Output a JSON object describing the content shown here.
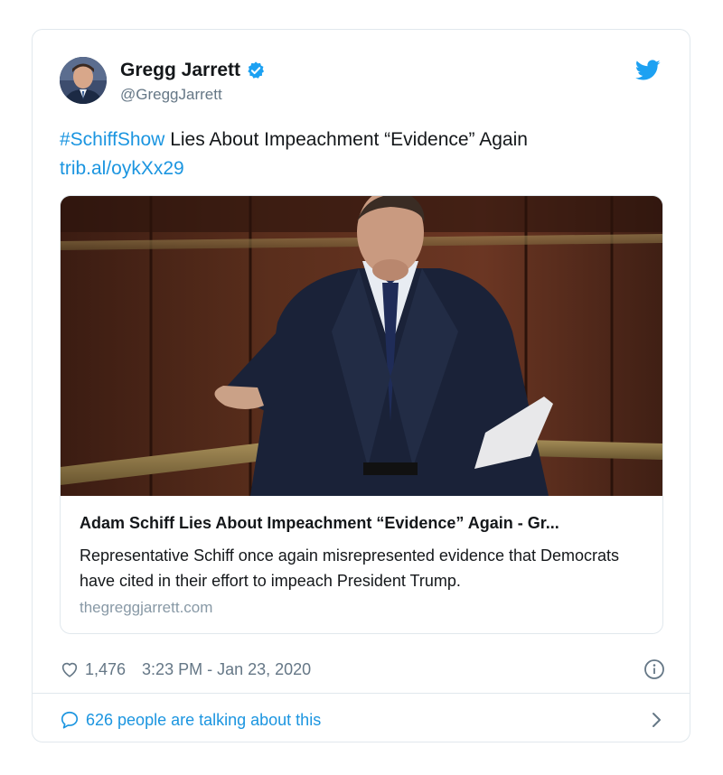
{
  "author": {
    "name": "Gregg Jarrett",
    "handle": "@GreggJarrett"
  },
  "tweet": {
    "hashtag": "#SchiffShow",
    "text": " Lies About Impeachment “Evidence” Again",
    "link": "trib.al/oykXx29"
  },
  "link_card": {
    "title": "Adam Schiff Lies About Impeachment “Evidence” Again - Gr...",
    "description": "Representative Schiff once again misrepresented evidence that Democrats have cited in their effort to impeach President Trump.",
    "domain": "thegreggjarrett.com"
  },
  "meta": {
    "likes": "1,476",
    "timestamp": "3:23 PM - Jan 23, 2020"
  },
  "conversation": {
    "label": "626 people are talking about this"
  },
  "icons": {
    "verified": "verified-badge-icon",
    "bird": "twitter-bird-icon",
    "heart": "heart-icon",
    "info": "info-icon",
    "bubble": "speech-bubble-icon",
    "chevron": "chevron-right-icon"
  },
  "colors": {
    "link": "#1b95e0",
    "muted": "#657786",
    "border": "#e1e8ed"
  }
}
